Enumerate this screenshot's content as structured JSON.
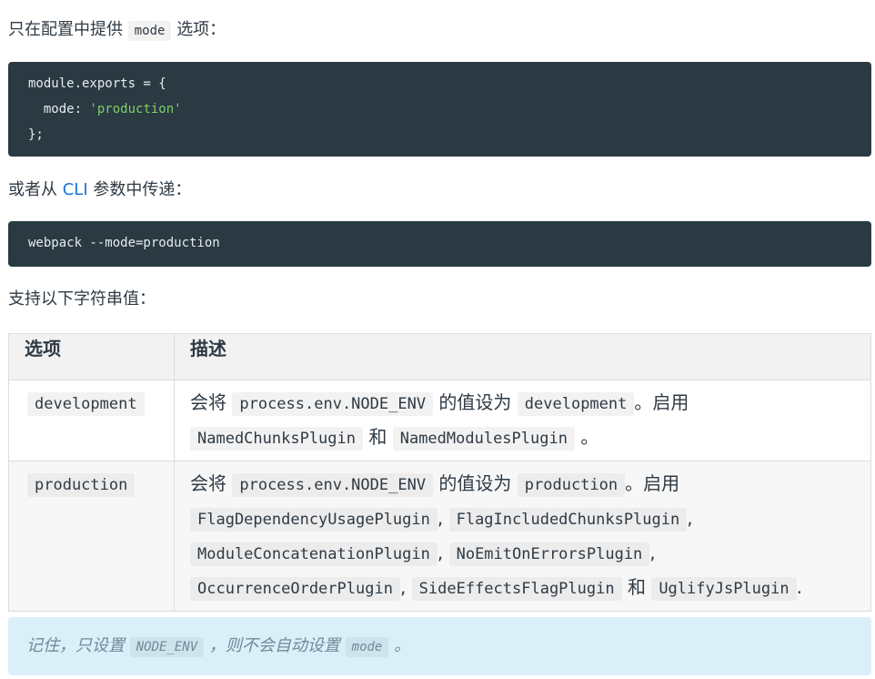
{
  "intro": {
    "prefix": "只在配置中提供",
    "code": "mode",
    "suffix": "选项："
  },
  "code_config": {
    "line1": "module.exports = {",
    "line2_key": "  mode: ",
    "line2_value": "'production'",
    "line3": "};"
  },
  "cli_para": {
    "prefix": "或者从",
    "link": "CLI",
    "suffix": "参数中传递："
  },
  "code_cli": {
    "line1": "webpack --mode=production"
  },
  "support_para": "支持以下字符串值：",
  "table": {
    "headers": [
      "选项",
      "描述"
    ],
    "rows": [
      {
        "option": "development",
        "desc": {
          "t1": "会将",
          "c1": "process.env.NODE_ENV",
          "t2": "的值设为",
          "c2": "development",
          "t3": "。启用",
          "p1": "NamedChunksPlugin",
          "and": "和",
          "p2": "NamedModulesPlugin",
          "end": "。"
        }
      },
      {
        "option": "production",
        "desc": {
          "t1": "会将",
          "c1": "process.env.NODE_ENV",
          "t2": "的值设为",
          "c2": "production",
          "t3": "。启用",
          "p1": "FlagDependencyUsagePlugin",
          "p2": "FlagIncludedChunksPlugin",
          "p3": "ModuleConcatenationPlugin",
          "p4": "NoEmitOnErrorsPlugin",
          "p5": "OccurrenceOrderPlugin",
          "p6": "SideEffectsFlagPlugin",
          "and": "和",
          "p7": "UglifyJsPlugin",
          "comma": ",",
          "end": "."
        }
      }
    ]
  },
  "note": {
    "prefix": "记住，只设置",
    "code1": "NODE_ENV",
    "middle": "，则不会自动设置",
    "code2": "mode",
    "end": "。"
  }
}
